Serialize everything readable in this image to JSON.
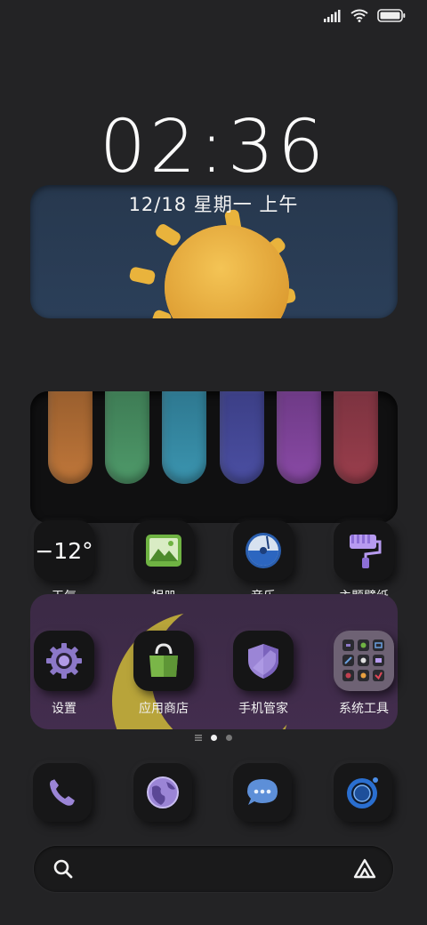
{
  "status_bar": {
    "signal_icon": "signal-bars-icon",
    "wifi_icon": "wifi-icon",
    "battery_icon": "battery-icon"
  },
  "lockclock": {
    "time": "02:36",
    "date": "12/18 星期一 上午"
  },
  "apps_row1": [
    {
      "label": "天气",
      "icon_text": "−12°",
      "icon": "weather-temperature-icon"
    },
    {
      "label": "相册",
      "icon": "gallery-icon"
    },
    {
      "label": "音乐",
      "icon": "music-icon"
    },
    {
      "label": "主题壁纸",
      "icon": "theme-paint-roller-icon"
    }
  ],
  "apps_row2": [
    {
      "label": "设置",
      "icon": "settings-gear-icon"
    },
    {
      "label": "应用商店",
      "icon": "app-store-bag-icon"
    },
    {
      "label": "手机管家",
      "icon": "security-shield-icon"
    },
    {
      "label": "系统工具",
      "icon": "system-tools-folder-icon"
    }
  ],
  "page_indicator": {
    "pages": 2,
    "current": 1
  },
  "dock": [
    {
      "icon": "phone-icon"
    },
    {
      "icon": "browser-globe-icon"
    },
    {
      "icon": "messages-icon"
    },
    {
      "icon": "camera-icon"
    }
  ],
  "search_bar": {
    "search_icon": "search-icon",
    "assistant_icon": "assistant-logo-icon"
  },
  "colors": {
    "background": "#232325",
    "weather_card": "#2b3f59",
    "moon_card": "#432d4e",
    "tube_orange": "#c0773a",
    "tube_green": "#4f9a6a",
    "tube_cyan": "#3b95b0",
    "tube_indigo": "#4b4fa3",
    "tube_purple": "#8a4aa6",
    "tube_red": "#9a3e4c"
  }
}
